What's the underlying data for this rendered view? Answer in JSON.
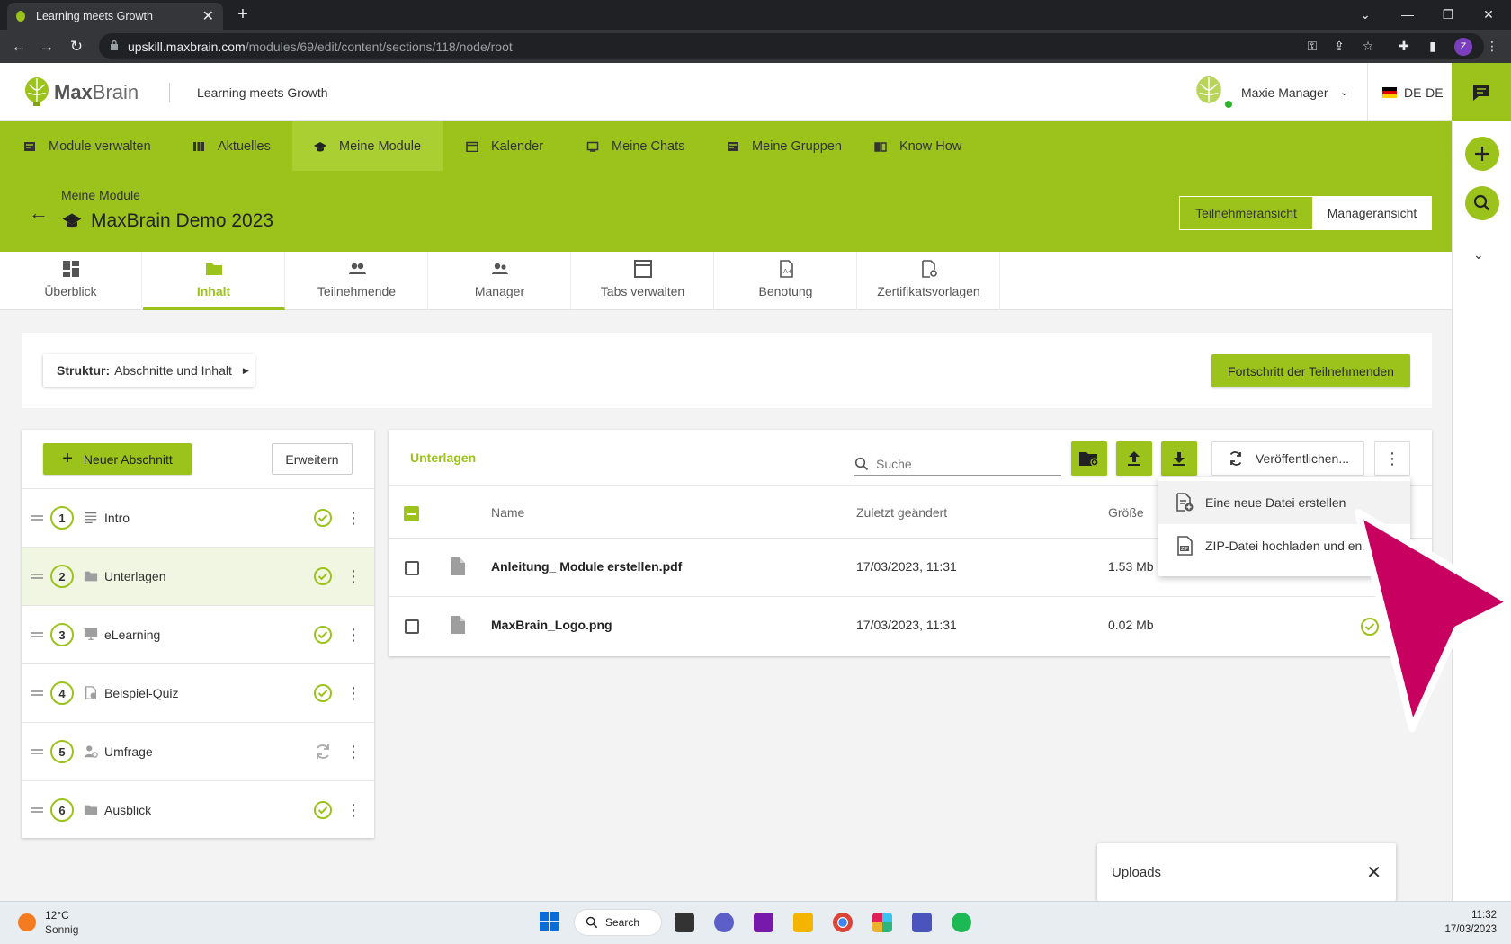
{
  "browser": {
    "tab_title": "Learning meets Growth",
    "url_host": "upskill.maxbrain.com",
    "url_path": "/modules/69/edit/content/sections/118/node/root",
    "profile_initial": "Z"
  },
  "header": {
    "brand_bold": "Max",
    "brand_light": "Brain",
    "tagline": "Learning meets Growth",
    "user_name": "Maxie Manager",
    "language": "DE-DE"
  },
  "nav": [
    {
      "label": "Module verwalten",
      "icon": "module-icon"
    },
    {
      "label": "Aktuelles",
      "icon": "news-icon"
    },
    {
      "label": "Meine Module",
      "icon": "graduation-cap-icon",
      "active": true
    },
    {
      "label": "Kalender",
      "icon": "calendar-icon"
    },
    {
      "label": "Meine Chats",
      "icon": "chat-icon"
    },
    {
      "label": "Meine Gruppen",
      "icon": "groups-icon"
    },
    {
      "label": "Know How",
      "icon": "book-icon"
    }
  ],
  "module": {
    "breadcrumb": "Meine Module",
    "title": "MaxBrain Demo 2023",
    "view_participant": "Teilnehmeransicht",
    "view_manager": "Manageransicht"
  },
  "tabs": [
    {
      "label": "Überblick",
      "icon": "dashboard-icon"
    },
    {
      "label": "Inhalt",
      "icon": "folder-icon",
      "active": true
    },
    {
      "label": "Teilnehmende",
      "icon": "people-icon"
    },
    {
      "label": "Manager",
      "icon": "manager-icon"
    },
    {
      "label": "Tabs verwalten",
      "icon": "window-icon"
    },
    {
      "label": "Benotung",
      "icon": "grade-icon"
    },
    {
      "label": "Zertifikatsvorlagen",
      "icon": "certificate-icon"
    }
  ],
  "structure": {
    "label_bold": "Struktur:",
    "label_value": "Abschnitte und Inhalt",
    "progress_button": "Fortschritt der Teilnehmenden"
  },
  "sections": {
    "new_button": "Neuer Abschnitt",
    "expand_button": "Erweitern",
    "items": [
      {
        "num": "1",
        "name": "Intro",
        "icon": "text-lines-icon",
        "status": "published"
      },
      {
        "num": "2",
        "name": "Unterlagen",
        "icon": "folder-icon",
        "status": "published",
        "selected": true
      },
      {
        "num": "3",
        "name": "eLearning",
        "icon": "monitor-icon",
        "status": "published"
      },
      {
        "num": "4",
        "name": "Beispiel-Quiz",
        "icon": "quiz-icon",
        "status": "published"
      },
      {
        "num": "5",
        "name": "Umfrage",
        "icon": "survey-icon",
        "status": "syncing"
      },
      {
        "num": "6",
        "name": "Ausblick",
        "icon": "folder-icon",
        "status": "published"
      }
    ]
  },
  "files": {
    "folder_title": "Unterlagen",
    "search_placeholder": "Suche",
    "publish_button": "Veröffentlichen...",
    "columns": {
      "name": "Name",
      "modified": "Zuletzt geändert",
      "size": "Größe"
    },
    "rows": [
      {
        "name": "Anleitung_ Module erstellen.pdf",
        "modified": "17/03/2023, 11:31",
        "size": "1.53 Mb"
      },
      {
        "name": "MaxBrain_Logo.png",
        "modified": "17/03/2023, 11:31",
        "size": "0.02 Mb"
      }
    ],
    "menu": [
      {
        "label": "Eine neue Datei erstellen",
        "icon": "new-file-icon"
      },
      {
        "label": "ZIP-Datei hochladen und entpacken",
        "icon": "zip-file-icon"
      }
    ]
  },
  "uploads": {
    "title": "Uploads"
  },
  "taskbar": {
    "temperature": "12°C",
    "weather": "Sonnig",
    "search_label": "Search",
    "time": "11:32",
    "date": "17/03/2023"
  },
  "colors": {
    "brand_green": "#9bc31c",
    "cursor_magenta": "#c8005f"
  }
}
